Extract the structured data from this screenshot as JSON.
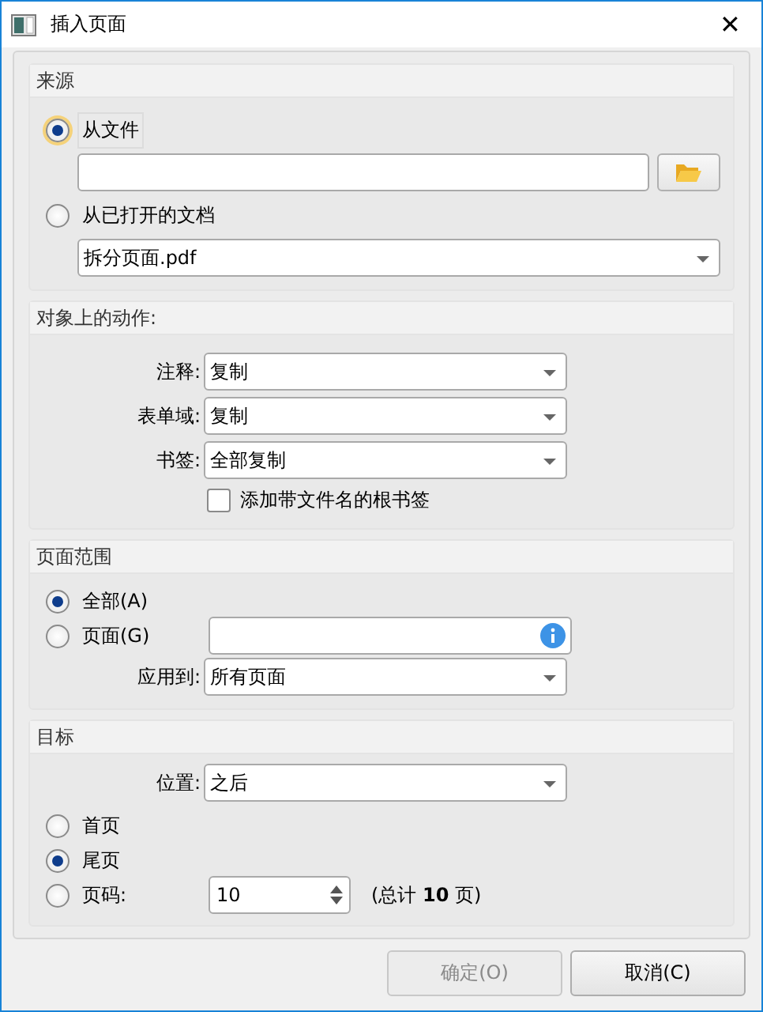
{
  "window": {
    "title": "插入页面",
    "close": "✕"
  },
  "source": {
    "title": "来源",
    "options": [
      {
        "label": "从文件",
        "selected": true,
        "focused": true
      },
      {
        "label": "从已打开的文档",
        "selected": false,
        "focused": false
      }
    ],
    "document": {
      "value": "拆分页面.pdf"
    }
  },
  "actions": {
    "title": "对象上的动作:",
    "rows": [
      {
        "label": "注释:",
        "value": "复制"
      },
      {
        "label": "表单域:",
        "value": "复制"
      },
      {
        "label": "书签:",
        "value": "全部复制"
      }
    ],
    "root_bookmark": {
      "label": "添加带文件名的根书签",
      "checked": false
    }
  },
  "page_range": {
    "title": "页面范围",
    "options": [
      {
        "label": "全部(A)",
        "selected": true
      },
      {
        "label": "页面(G)",
        "selected": false
      }
    ],
    "apply_to": {
      "label": "应用到:",
      "value": "所有页面"
    }
  },
  "target": {
    "title": "目标",
    "position": {
      "label": "位置:",
      "value": "之后"
    },
    "options": [
      {
        "label": "首页",
        "selected": false
      },
      {
        "label": "尾页",
        "selected": true
      },
      {
        "label": "页码:",
        "selected": false
      }
    ],
    "page_number": {
      "value": "10"
    },
    "total": "(总计 **10** 页)"
  },
  "buttons": [
    {
      "label": "确定(O)",
      "disabled": true
    },
    {
      "label": "取消(C)",
      "disabled": false
    }
  ]
}
